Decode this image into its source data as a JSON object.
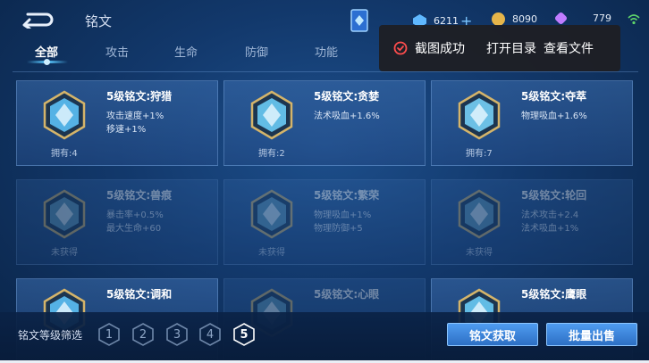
{
  "header": {
    "title": "铭文",
    "currencies": [
      {
        "icon": "diamond-icon",
        "value": "6211",
        "color": "#5fb8ff"
      },
      {
        "icon": "gold-coin-icon",
        "value": "8090",
        "color": "#e6b54a"
      },
      {
        "icon": "purple-gem-icon",
        "value": "779",
        "color": "#c07cff"
      }
    ]
  },
  "tabs": [
    "全部",
    "攻击",
    "生命",
    "防御",
    "功能"
  ],
  "active_tab": "全部",
  "toast": {
    "message": "截图成功",
    "open_dir": "打开目录",
    "view_file": "查看文件"
  },
  "cards": [
    {
      "name": "5级铭文:狩猎",
      "stats": [
        "攻击速度+1%",
        "移速+1%"
      ],
      "owned": "拥有:4",
      "obtained": true,
      "gem_color": "#5fc8ff"
    },
    {
      "name": "5级铭文:贪婪",
      "stats": [
        "法术吸血+1.6%"
      ],
      "owned": "拥有:2",
      "obtained": true,
      "gem_color": "#6fd4ff"
    },
    {
      "name": "5级铭文:夺萃",
      "stats": [
        "物理吸血+1.6%"
      ],
      "owned": "拥有:7",
      "obtained": true,
      "gem_color": "#7ad8ff"
    },
    {
      "name": "5级铭文:兽痕",
      "stats": [
        "暴击率+0.5%",
        "最大生命+60"
      ],
      "owned": "未获得",
      "obtained": false,
      "gem_color": "#6aa8c8"
    },
    {
      "name": "5级铭文:繁荣",
      "stats": [
        "物理吸血+1%",
        "物理防御+5"
      ],
      "owned": "未获得",
      "obtained": false,
      "gem_color": "#6aa8c8"
    },
    {
      "name": "5级铭文:轮回",
      "stats": [
        "法术攻击+2.4",
        "法术吸血+1%"
      ],
      "owned": "未获得",
      "obtained": false,
      "gem_color": "#6aa8c8"
    },
    {
      "name": "5级铭文:调和",
      "stats": [],
      "owned": "",
      "obtained": true,
      "gem_color": "#5fc8ff"
    },
    {
      "name": "5级铭文:心眼",
      "stats": [],
      "owned": "",
      "obtained": false,
      "gem_color": "#6aa8c8"
    },
    {
      "name": "5级铭文:鹰眼",
      "stats": [],
      "owned": "",
      "obtained": true,
      "gem_color": "#6fd4ff"
    }
  ],
  "bottom": {
    "filter_label": "铭文等级筛选",
    "levels": [
      "1",
      "2",
      "3",
      "4",
      "5"
    ],
    "active_level": "5",
    "acquire_button": "铭文获取",
    "bulk_sell_button": "批量出售"
  }
}
